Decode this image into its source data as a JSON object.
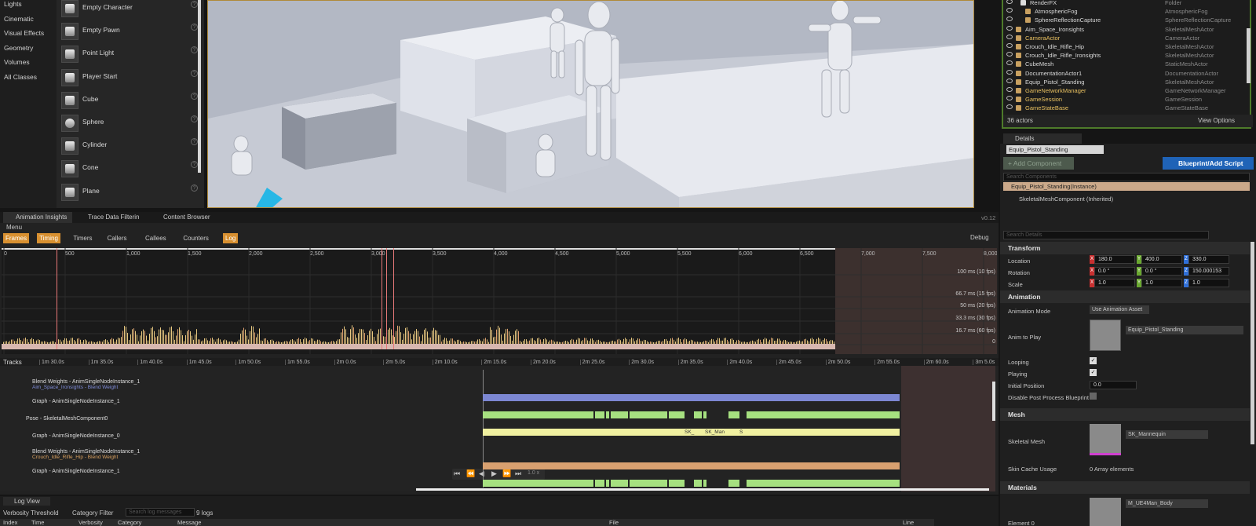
{
  "categories": [
    "Lights",
    "Cinematic",
    "Visual Effects",
    "Geometry",
    "Volumes",
    "All Classes"
  ],
  "actors": [
    "Empty Character",
    "Empty Pawn",
    "Point Light",
    "Player Start",
    "Cube",
    "Sphere",
    "Cylinder",
    "Cone",
    "Plane"
  ],
  "outliner": {
    "rows": [
      {
        "name": "RenderFX",
        "type": "Folder",
        "color": "#d8d8d8",
        "indent": 1
      },
      {
        "name": "AtmosphericFog",
        "type": "AtmosphericFog",
        "color": "#d8d8d8",
        "indent": 2
      },
      {
        "name": "SphereReflectionCapture",
        "type": "SphereReflectionCapture",
        "color": "#d8d8d8",
        "indent": 2
      },
      {
        "name": "Aim_Space_Ironsights",
        "type": "SkeletalMeshActor",
        "color": "#d8d8d8",
        "indent": 0
      },
      {
        "name": "CameraActor",
        "type": "CameraActor",
        "color": "#e8c060",
        "indent": 0
      },
      {
        "name": "Crouch_Idle_Rifle_Hip",
        "type": "SkeletalMeshActor",
        "color": "#d8d8d8",
        "indent": 0
      },
      {
        "name": "Crouch_Idle_Rifle_Ironsights",
        "type": "SkeletalMeshActor",
        "color": "#d8d8d8",
        "indent": 0
      },
      {
        "name": "CubeMesh",
        "type": "StaticMeshActor",
        "color": "#d8d8d8",
        "indent": 0
      },
      {
        "name": "DocumentationActor1",
        "type": "DocumentationActor",
        "color": "#d8d8d8",
        "indent": 0
      },
      {
        "name": "Equip_Pistol_Standing",
        "type": "SkeletalMeshActor",
        "color": "#d8d8d8",
        "indent": 0
      },
      {
        "name": "GameNetworkManager",
        "type": "GameNetworkManager",
        "color": "#e8c060",
        "indent": 0
      },
      {
        "name": "GameSession",
        "type": "GameSession",
        "color": "#e8c060",
        "indent": 0
      },
      {
        "name": "GameStateBase",
        "type": "GameStateBase",
        "color": "#e8c060",
        "indent": 0
      }
    ],
    "count": "36 actors",
    "view_options": "View Options"
  },
  "details": {
    "tab": "Details",
    "actor_name": "Equip_Pistol_Standing",
    "add_component": "+ Add Component",
    "blueprint": "Blueprint/Add Script",
    "search_components": "Search Components",
    "instance": "Equip_Pistol_Standing(Instance)",
    "component": "SkeletalMeshComponent (Inherited)",
    "search_details": "Search Details",
    "transform": "Transform",
    "location": "Location",
    "rotation": "Rotation",
    "scale": "Scale",
    "loc": [
      "180.0",
      "400.0",
      "330.0"
    ],
    "rot": [
      "0.0 °",
      "0.0 °",
      "150.000153"
    ],
    "scl": [
      "1.0",
      "1.0",
      "1.0"
    ],
    "animation": "Animation",
    "anim_mode_label": "Animation Mode",
    "anim_mode": "Use Animation Asset",
    "anim_to_play_label": "Anim to Play",
    "anim_to_play": "Equip_Pistol_Standing",
    "looping": "Looping",
    "playing": "Playing",
    "initial_position": "Initial Position",
    "initial_value": "0.0",
    "disable_pp": "Disable Post Process Blueprint",
    "mesh": "Mesh",
    "skeletal_mesh_label": "Skeletal Mesh",
    "skeletal_mesh": "SK_Mannequin",
    "skin_cache": "Skin Cache Usage",
    "array_elements": "0 Array elements",
    "materials": "Materials",
    "element0": "Element 0",
    "material": "M_UE4Man_Body"
  },
  "insights": {
    "tabs": [
      "Animation Insights",
      "Trace Data Filterin",
      "Content Browser"
    ],
    "version": "v0.12",
    "menu": "Menu",
    "toolbar": [
      "Frames",
      "Timing",
      "Timers",
      "Callers",
      "Callees",
      "Counters",
      "Log"
    ],
    "toolbar_on": [
      true,
      true,
      false,
      false,
      false,
      false,
      true
    ],
    "debug": "Debug",
    "frame_ticks": [
      "0",
      "500",
      "1,000",
      "1,500",
      "2,000",
      "2,500",
      "3,000",
      "3,500",
      "4,000",
      "4,500",
      "5,000",
      "5,500",
      "6,000",
      "6,500",
      "7,000",
      "7,500",
      "8,000"
    ],
    "fps_labels": [
      "100 ms (10 fps)",
      "66.7 ms (15 fps)",
      "50 ms (20 fps)",
      "33.3 ms (30 fps)",
      "16.7 ms (60 fps)",
      "0"
    ],
    "tracks_label": "Tracks",
    "time_ticks": [
      "1m 30.0s",
      "1m 35.0s",
      "1m 40.0s",
      "1m 45.0s",
      "1m 50.0s",
      "1m 55.0s",
      "2m 0.0s",
      "2m 5.0s",
      "2m 10.0s",
      "2m 15.0s",
      "2m 20.0s",
      "2m 25.0s",
      "2m 30.0s",
      "2m 35.0s",
      "2m 40.0s",
      "2m 45.0s",
      "2m 50.0s",
      "2m 55.0s",
      "2m 60.0s",
      "3m 5.0s"
    ],
    "tracks": [
      {
        "title": "Blend Weights - AnimSingleNodeInstance_1",
        "sub": "Aim_Space_Ironsights - Blend Weight",
        "subcolor": "#7f8cd8"
      },
      {
        "title": "Graph - AnimSingleNodeInstance_1",
        "sub": "",
        "subcolor": ""
      },
      {
        "title": "Pose - SkeletalMeshComponent0",
        "sub": "",
        "subcolor": ""
      },
      {
        "title": "Graph - AnimSingleNodeInstance_0",
        "sub": "",
        "subcolor": ""
      },
      {
        "title": "Blend Weights - AnimSingleNodeInstance_1",
        "sub": "Crouch_Idle_Rifle_Hip - Blend Weight",
        "subcolor": "#d8a060"
      },
      {
        "title": "Graph - AnimSingleNodeInstance_1",
        "sub": "",
        "subcolor": ""
      }
    ],
    "pose_labels": [
      "SK_",
      "SK_Man",
      "S"
    ],
    "speed": "1.0 x"
  },
  "log": {
    "tab": "Log View",
    "verbosity": "Verbosity Threshold",
    "category": "Category Filter",
    "search": "Search log messages",
    "count": "9 logs",
    "columns": [
      "Index",
      "Time",
      "Verbosity",
      "Category",
      "Message",
      "File",
      "Line"
    ]
  }
}
